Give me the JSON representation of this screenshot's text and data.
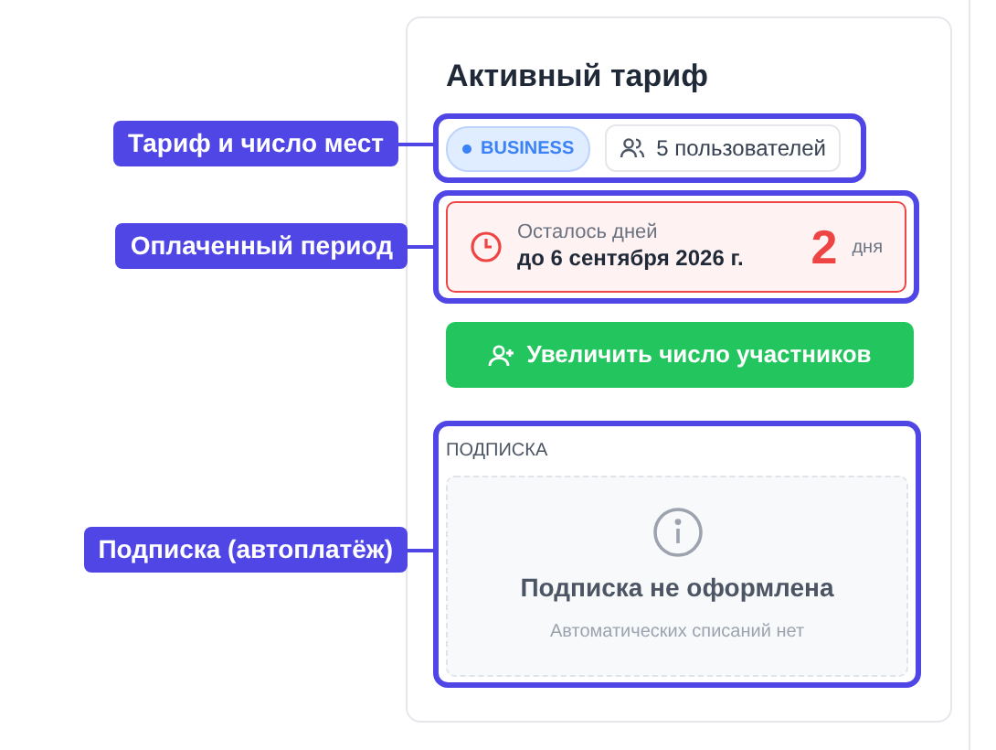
{
  "annotations": [
    {
      "label": "Тариф и число мест"
    },
    {
      "label": "Оплаченный период"
    },
    {
      "label": "Подписка (автоплатёж)"
    }
  ],
  "card": {
    "title": "Активный тариф",
    "plan_badge": "BUSINESS",
    "users": "5 пользователей",
    "period": {
      "caption": "Осталось дней",
      "date": "до 6 сентября 2026 г.",
      "days": "2",
      "days_unit": "дня"
    },
    "button": "Увеличить число участников",
    "subscription": {
      "heading": "ПОДПИСКА",
      "title": "Подписка не оформлена",
      "note": "Автоматических списаний нет"
    }
  }
}
